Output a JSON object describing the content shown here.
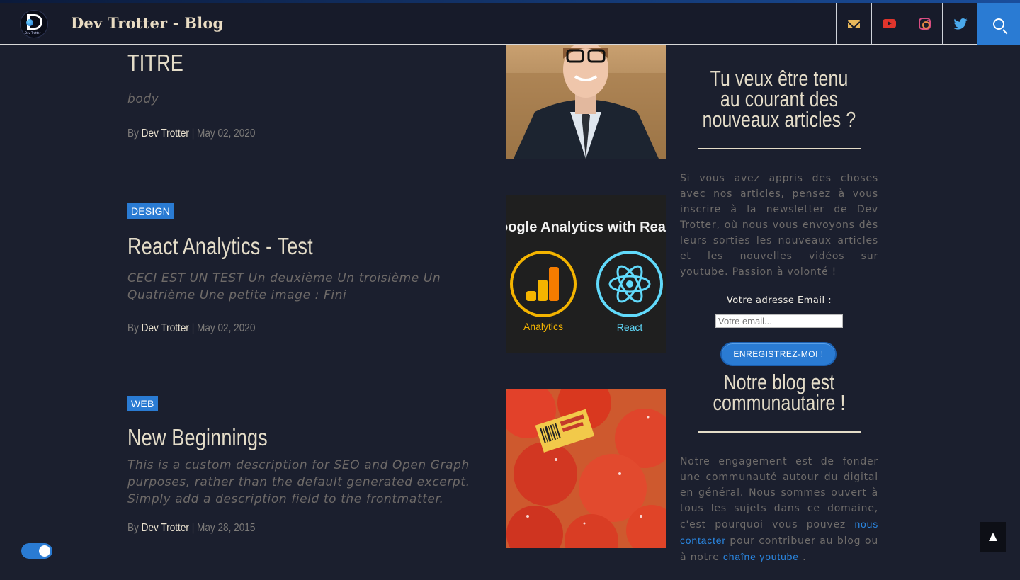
{
  "header": {
    "site_title": "Dev Trotter - Blog",
    "logo_text": "Dev Trotter",
    "social_icons": [
      "mail-icon",
      "youtube-icon",
      "instagram-icon",
      "twitter-icon",
      "search-icon"
    ]
  },
  "posts": [
    {
      "category": "",
      "title": "TITRE",
      "excerpt": "body",
      "by": "By",
      "author": "Dev Trotter",
      "date": "| May 02, 2020"
    },
    {
      "category": "DESIGN",
      "title": "React Analytics - Test",
      "excerpt": "CECI EST UN TEST Un deuxième Un troisième Un Quatrième Une petite image : Fini",
      "by": "By",
      "author": "Dev Trotter",
      "date": "| May 02, 2020",
      "thumb": {
        "heading": "oogle Analytics with Rea",
        "left_label": "Analytics",
        "right_label": "React"
      }
    },
    {
      "category": "WEB",
      "title": "New Beginnings",
      "excerpt": "This is a custom description for SEO and Open Graph purposes, rather than the default generated excerpt. Simply add a description field to the frontmatter.",
      "by": "By",
      "author": "Dev Trotter",
      "date": "| May 28, 2015"
    }
  ],
  "sidebar": {
    "newsletter_title": "Tu veux être tenu au courant des nouveaux articles ?",
    "newsletter_text": "Si vous avez appris des choses avec nos articles, pensez à vous inscrire à la newsletter de Dev Trotter, où nous vous envoyons dès leurs sorties les nouveaux articles et les nouvelles vidéos sur youtube. Passion à volonté !",
    "email_label": "Votre adresse Email :",
    "email_placeholder": "Votre email...",
    "submit_label": "ENREGISTREZ-MOI !",
    "community_title": "Notre blog est communautaire !",
    "community_text_1": "Notre engagement est de fonder une communauté autour du digital en général. Nous sommes ouvert à tous les sujets dans ce domaine, c'est pourquoi vous pouvez",
    "contact_link": "nous contacter",
    "community_text_2": "pour contribuer au blog ou à notre",
    "youtube_link": "chaîne youtube",
    "community_text_3": "."
  },
  "colors": {
    "accent": "#2a7bd3",
    "background": "#1b1f2e",
    "header": "#171b2a",
    "title_text": "#e4dcc8"
  }
}
